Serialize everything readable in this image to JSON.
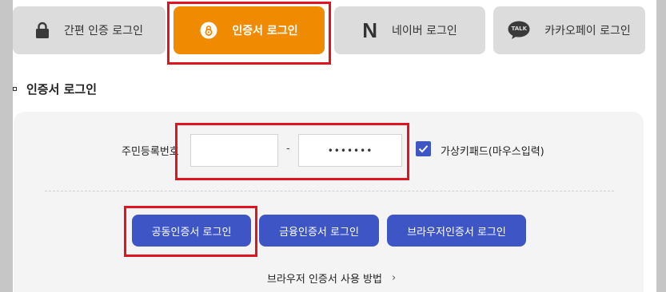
{
  "tabs": {
    "simple": {
      "label": "간편 인증 로그인",
      "icon": "lock-icon"
    },
    "cert": {
      "label": "인증서 로그인",
      "icon": "certificate-icon"
    },
    "naver": {
      "label": "네이버 로그인",
      "icon": "naver-logo-icon",
      "logo_text": "N"
    },
    "kakao": {
      "label": "카카오페이 로그인",
      "icon": "kakao-talk-icon",
      "logo_text": "TALK"
    }
  },
  "section": {
    "title": "인증서 로그인"
  },
  "form": {
    "rrn_label": "주민등록번호",
    "rrn_front_value": "",
    "rrn_separator": "-",
    "rrn_back_value": "•••••••",
    "virtual_keypad_label": "가상키패드(마우스입력)",
    "virtual_keypad_checked": true
  },
  "buttons": {
    "joint_cert": "공동인증서 로그인",
    "financial_cert": "금융인증서 로그인",
    "browser_cert": "브라우저인증서 로그인"
  },
  "help_link": {
    "label": "브라우저 인증서 사용 방법",
    "chevron": "›"
  },
  "colors": {
    "active_tab": "#f08a00",
    "tab_inactive": "#dcdcdc",
    "primary_button": "#3e55c6",
    "highlight": "#e0141e",
    "backdrop": "#c6c6c6",
    "card": "#f4f4f4"
  }
}
